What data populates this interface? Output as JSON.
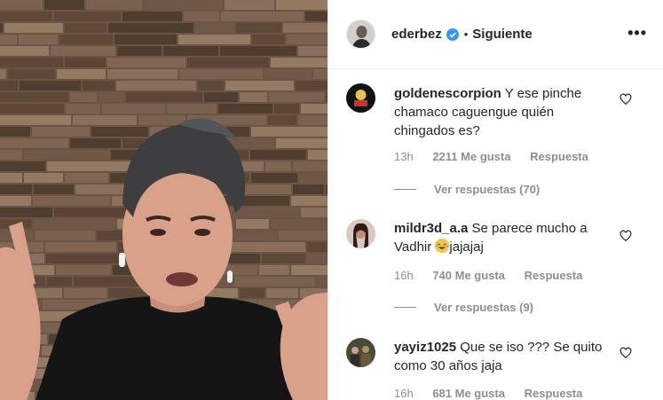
{
  "header": {
    "username": "ederbez",
    "separator": "•",
    "follow_label": "Siguiente",
    "more_label": "•••"
  },
  "comments": [
    {
      "username": "goldenescorpion",
      "text": "Y ese pinche chamaco caguengue quién chingados es?",
      "time": "13h",
      "likes": "2211 Me gusta",
      "reply_label": "Respuesta",
      "view_replies": "Ver respuestas (70)"
    },
    {
      "username": "mildr3d_a.a",
      "text_before": "Se parece mucho a Vadhir ",
      "text_after": "jajajaj",
      "emoji": "laughing-emoji",
      "time": "16h",
      "likes": "740 Me gusta",
      "reply_label": "Respuesta",
      "view_replies": "Ver respuestas (9)"
    },
    {
      "username": "yayiz1025",
      "text": "Que se iso ??? Se quito como 30 años jaja",
      "time": "16h",
      "likes": "681 Me gusta",
      "reply_label": "Respuesta"
    }
  ],
  "colors": {
    "text": "#262626",
    "muted": "#8e8e8e",
    "verified": "#3897f0",
    "divider": "#efefef"
  }
}
